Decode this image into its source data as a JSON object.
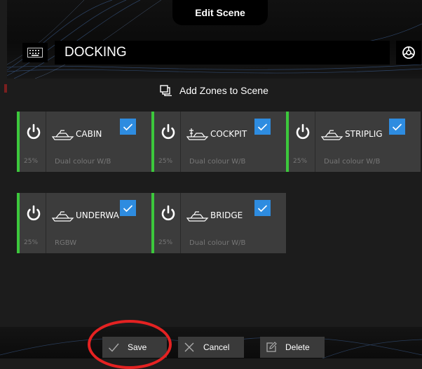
{
  "header": {
    "title": "Edit Scene",
    "scene_name": "DOCKING",
    "keyboard_icon": "keyboard-icon",
    "wheel_icon": "steering-wheel-icon"
  },
  "add_zones": {
    "label": "Add Zones to Scene",
    "icon": "layers-icon"
  },
  "zones": [
    {
      "name": "CABIN",
      "type": "Dual colour W/B",
      "level": "25%",
      "checked": true
    },
    {
      "name": "COCKPIT",
      "type": "Dual colour W/B",
      "level": "25%",
      "checked": true
    },
    {
      "name": "STRIPLIGHT",
      "display_name": "STRIPLIG",
      "type": "Dual colour W/B",
      "level": "25%",
      "checked": true
    },
    {
      "name": "UNDERWATER",
      "display_name": "UNDERWA",
      "type": "RGBW",
      "level": "25%",
      "checked": true
    },
    {
      "name": "BRIDGE",
      "type": "Dual colour W/B",
      "level": "25%",
      "checked": true
    }
  ],
  "footer": {
    "save_label": "Save",
    "cancel_label": "Cancel",
    "delete_label": "Delete"
  },
  "colors": {
    "accent": "#2e8ce0",
    "power_on": "#3cc83c",
    "annotation": "#e42222"
  }
}
